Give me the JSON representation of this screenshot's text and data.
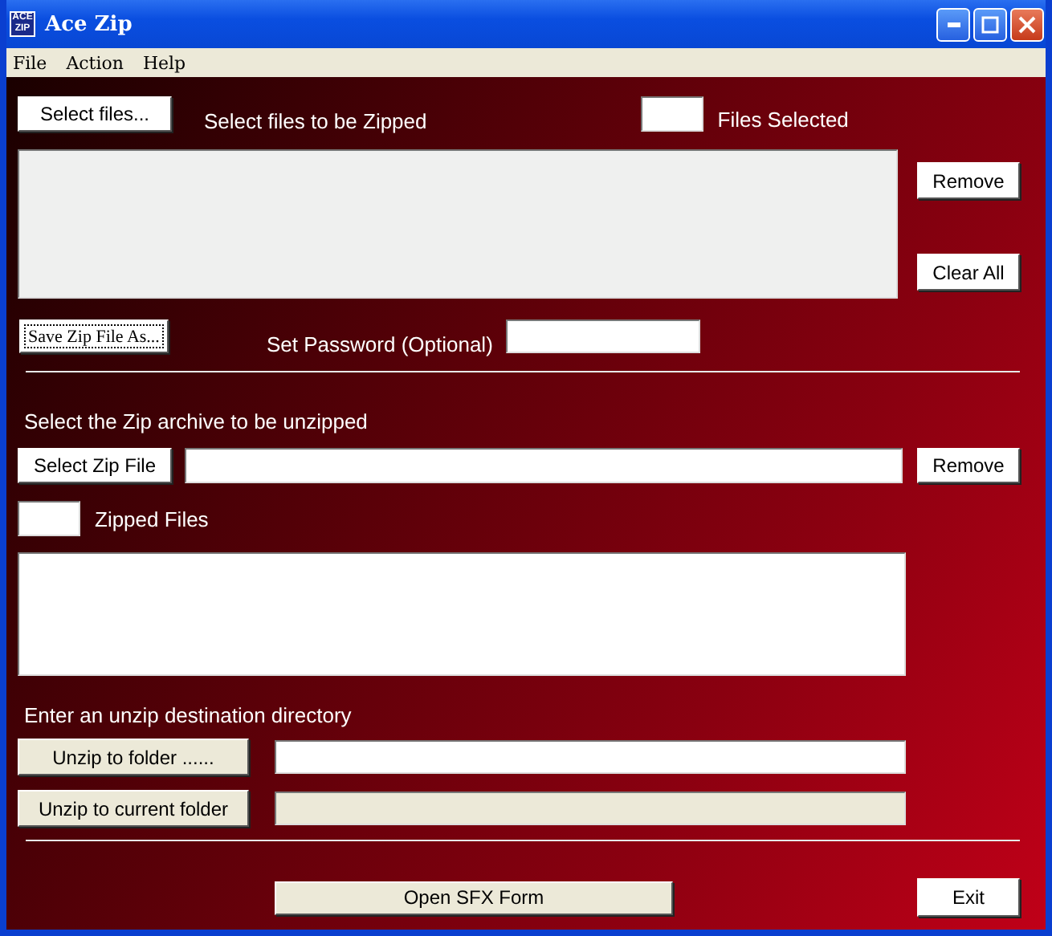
{
  "window": {
    "title": "Ace Zip",
    "logo_lines": [
      "ACE",
      "ZIP"
    ]
  },
  "menu": [
    "File",
    "Action",
    "Help"
  ],
  "zip_section": {
    "select_button": "Select files...",
    "caption": "Select files to be Zipped",
    "count_label": "Files Selected",
    "remove_button": "Remove",
    "clear_button": "Clear All",
    "save_button": {
      "label": "Save Zip File As...",
      "focused": true
    },
    "password_label": "Set Password (Optional)"
  },
  "unzip_section": {
    "caption": "Select the Zip archive to be unzipped",
    "select_button": "Select Zip File",
    "remove_button": "Remove",
    "count_label": "Zipped Files"
  },
  "destination": {
    "caption": "Enter an unzip destination directory",
    "rows": [
      {
        "button": "Unzip to folder ......",
        "disabled": false
      },
      {
        "button": "Unzip to current folder",
        "disabled": true
      }
    ]
  },
  "footer": {
    "sfx_button": "Open SFX Form",
    "exit_button": "Exit"
  }
}
